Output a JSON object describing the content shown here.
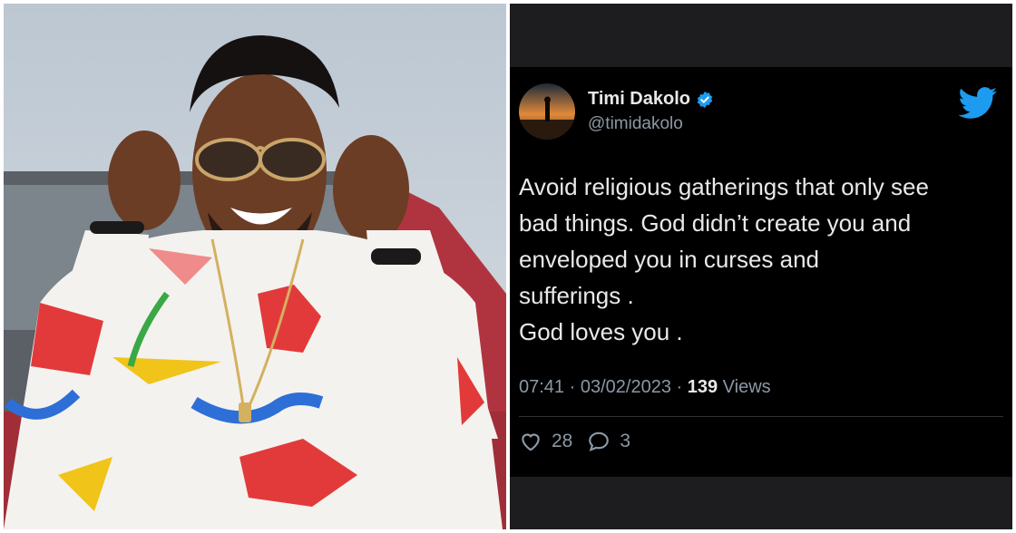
{
  "tweet": {
    "display_name": "Timi Dakolo",
    "handle": "@timidakolo",
    "text": "Avoid religious gatherings that only see\nbad things. God didn’t create you and\nenveloped you in curses and\nsufferings .\nGod loves you .",
    "time": "07:41",
    "separator": " · ",
    "date": "03/02/2023",
    "views_count": "139",
    "views_label": " Views",
    "likes": "28",
    "replies": "3"
  },
  "colors": {
    "twitter_blue": "#1d9bf0",
    "card_bg": "#000000",
    "text_primary": "#e7e9ea",
    "text_secondary": "#8b98a5"
  },
  "icons": {
    "verified": "verified-badge-icon",
    "logo": "twitter-bird-icon",
    "like": "heart-icon",
    "reply": "reply-bubble-icon"
  }
}
